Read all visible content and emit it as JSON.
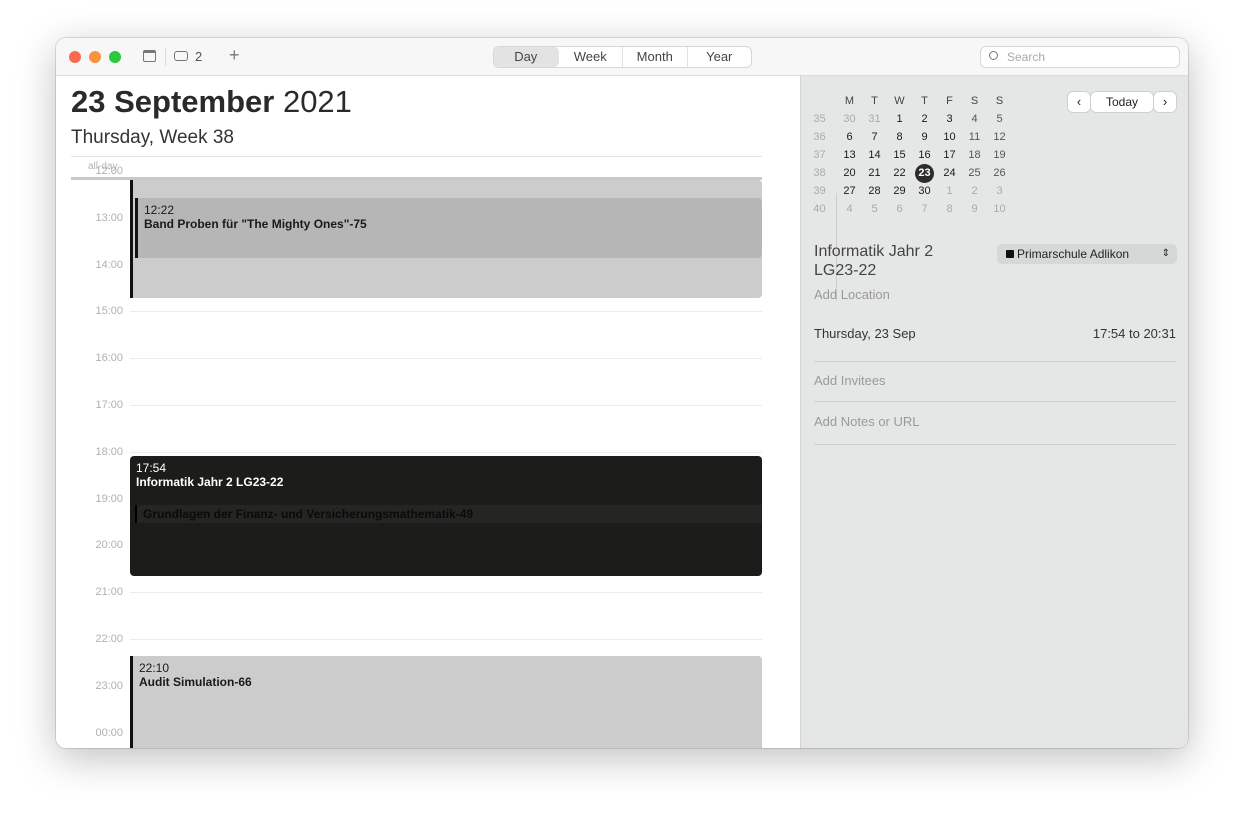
{
  "toolbar": {
    "inbox_count": "2",
    "views": [
      "Day",
      "Week",
      "Month",
      "Year"
    ],
    "active_view": "Day",
    "search_placeholder": "Search"
  },
  "header": {
    "date_bold": "23 September",
    "year": "2021",
    "subtitle": "Thursday, Week 38",
    "allday": "all-day"
  },
  "hours": [
    "12:00",
    "13:00",
    "14:00",
    "15:00",
    "16:00",
    "17:00",
    "18:00",
    "19:00",
    "20:00",
    "21:00",
    "22:00",
    "23:00",
    "00:00"
  ],
  "events": [
    {
      "time": "12:22",
      "title": "Band Proben für \"The Mighty Ones\"-75"
    },
    {
      "time": "17:54",
      "title": "Informatik Jahr 2 LG23-22"
    },
    {
      "time": "",
      "title": "Grundlagen der Finanz- und Versicherungsmathematik-49"
    },
    {
      "time": "22:10",
      "title": "Audit Simulation-66"
    }
  ],
  "mini_calendar": {
    "weekdays": [
      "M",
      "T",
      "W",
      "T",
      "F",
      "S",
      "S"
    ],
    "today_label": "Today",
    "selected": "23",
    "weeks": [
      {
        "num": "35",
        "days": [
          "30",
          "31",
          "1",
          "2",
          "3",
          "4",
          "5"
        ]
      },
      {
        "num": "36",
        "days": [
          "6",
          "7",
          "8",
          "9",
          "10",
          "11",
          "12"
        ]
      },
      {
        "num": "37",
        "days": [
          "13",
          "14",
          "15",
          "16",
          "17",
          "18",
          "19"
        ]
      },
      {
        "num": "38",
        "days": [
          "20",
          "21",
          "22",
          "23",
          "24",
          "25",
          "26"
        ]
      },
      {
        "num": "39",
        "days": [
          "27",
          "28",
          "29",
          "30",
          "1",
          "2",
          "3"
        ]
      },
      {
        "num": "40",
        "days": [
          "4",
          "5",
          "6",
          "7",
          "8",
          "9",
          "10"
        ]
      }
    ]
  },
  "inspector": {
    "title": "Informatik Jahr 2 LG23-22",
    "calendar": "Primarschule Adlikon",
    "location_placeholder": "Add Location",
    "date": "Thursday, 23 Sep",
    "time_range": "17:54 to 20:31",
    "invitees_placeholder": "Add Invitees",
    "notes_placeholder": "Add Notes or URL"
  },
  "colors": {
    "event_dark": "#1c1d1b",
    "event_gray": "#cbcccb",
    "selected_day": "#2b2b2b"
  }
}
